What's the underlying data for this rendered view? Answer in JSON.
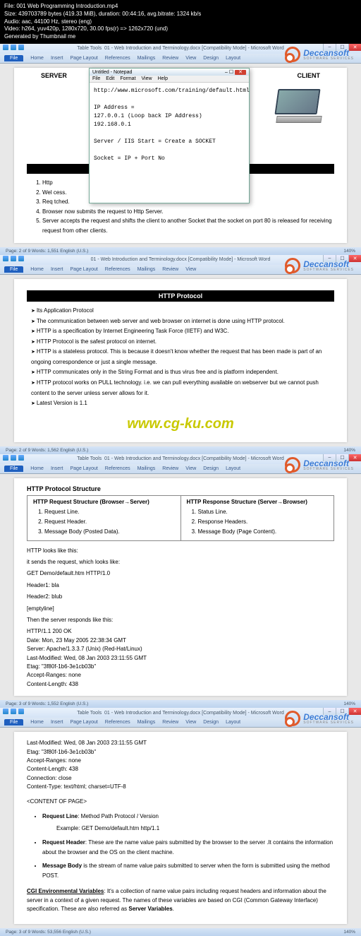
{
  "top_info": {
    "file": "File: 001 Web Programming Introduction.mp4",
    "size": "Size: 439703789 bytes (419.33 MiB), duration: 00:44:16, avg.bitrate: 1324 kb/s",
    "audio": "Audio: aac, 44100 Hz, stereo (eng)",
    "video": "Video: h264, yuv420p, 1280x720, 30.00 fps(r) => 1262x720 (und)",
    "gen": "Generated by Thumbnail me"
  },
  "word": {
    "title": "01 - Web Introduction and Terminology.docx [Compatibility Mode] - Microsoft Word",
    "tabs": [
      "File",
      "Home",
      "Insert",
      "Page Layout",
      "References",
      "Mailings",
      "Review",
      "View",
      "Design",
      "Layout"
    ],
    "table_tools": "Table Tools"
  },
  "logo": {
    "name": "Deccansoft",
    "sub": "SOFTWARE SERVICES"
  },
  "panel1": {
    "server_label": "SERVER",
    "client_label": "CLIENT",
    "list": [
      "Http",
      "Wel                                                                                              cess.",
      "Req                                                                                              tched.",
      "Browser now submits the request to Http Server.",
      "Server accepts the request and shifts the client to another Socket that the socket on port 80 is released for receiving request from other clients."
    ]
  },
  "notepad": {
    "title": "Untitled - Notepad",
    "menu": [
      "File",
      "Edit",
      "Format",
      "View",
      "Help"
    ],
    "body": "http://www.microsoft.com/training/default.html\n\nIP Address =\n127.0.0.1 (Loop back IP Address)\n192.168.0.1\n\nServer / IIS Start = Create a SOCKET\n\nSocket = IP + Port No"
  },
  "panel2": {
    "heading": "HTTP Protocol",
    "items": [
      "Its Application Protocol",
      "The communication between web server and web browser on internet is done using HTTP protocol.",
      "HTTP is a specification by Internet Engineering Task Force (IIETF) and W3C.",
      "HTTP Protocol is the safest protocol on internet.",
      "HTTP is a stateless protocol. This is because it doesn't know whether the request that has been made is part of an ongoing correspondence or just a single message.",
      "HTTP communicates only in the String Format and is thus virus free and is platform independent.",
      "HTTP protocol works on PULL technology. i.e. we can pull everything available on webserver but we cannot push content to the server unless server allows for it.",
      "Latest Version is 1.1"
    ]
  },
  "center_url": "www.cg-ku.com",
  "panel3": {
    "heading": "HTTP Protocol Structure",
    "req_hdr": "HTTP Request Structure (Browser→Server)",
    "req_items": [
      "Request Line.",
      "Request Header.",
      "Message Body (Posted Data)."
    ],
    "res_hdr": "HTTP Response Structure (Server→Browser)",
    "res_items": [
      "Status Line.",
      "Response Headers.",
      "Message Body (Page Content)."
    ],
    "looks1": "HTTP looks like this:",
    "looks2": "it sends the request, which looks like:",
    "req_example": "GET Demo/default.htm  HTTP/1.0",
    "h1": "Header1: bla",
    "h2": "Header2: blub",
    "empty": "[emptyline]",
    "resp_intro": "Then the server responds like this:",
    "resp_lines": [
      "HTTP/1.1 200 OK",
      "Date: Mon, 23 May 2005 22:38:34 GMT",
      "Server: Apache/1.3.3.7 (Unix) (Red-Hat/Linux)",
      "Last-Modified: Wed, 08 Jan 2003 23:11:55 GMT",
      "Etag: \"3f80f-1b6-3e1cb03b\"",
      "Accept-Ranges: none",
      "Content-Length: 438"
    ]
  },
  "panel4": {
    "cont_lines": [
      "Last-Modified: Wed, 08 Jan 2003 23:11:55 GMT",
      "Etag: \"3f80f-1b6-3e1cb03b\"",
      "Accept-Ranges: none",
      "Content-Length: 438",
      "Connection: close",
      "Content-Type: text/html; charset=UTF-8",
      "",
      "<CONTENT OF PAGE>"
    ],
    "b1_lead": "Request Line",
    "b1_rest": ":   Method Path Protocol / Version",
    "b1_ex": "Example:   GET Demo/default.htm  http/1.1",
    "b2_lead": "Request Header",
    "b2_rest": ": These are the name value pairs submitted by the browser to the server .It contains the information about the browser and the OS on the client machine.",
    "b3_lead": "Message Body",
    "b3_rest": " is the stream of name value pairs submitted  to server when the form is submitted using the method POST.",
    "cgi_lead": "CGI Environmental Variables",
    "cgi_rest": ": It's a collection of name value pairs including request headers and information about the server in a context of a given request. The names of these variables are based on CGI (Common Gateway Interface) specification. These are also referred as ",
    "cgi_bold": "Server Variables",
    "cgi_end": "."
  },
  "status": {
    "p1": "Page: 2 of 9    Words: 1,551    English (U.S.)",
    "p2": "Page: 2 of 9    Words: 1,562    English (U.S.)",
    "p3": "Page: 3 of 9    Words: 1,552    English (U.S.)",
    "p4": "Page: 3 of 9    Words: 53,556    English (U.S.)",
    "zoom": "140%"
  }
}
